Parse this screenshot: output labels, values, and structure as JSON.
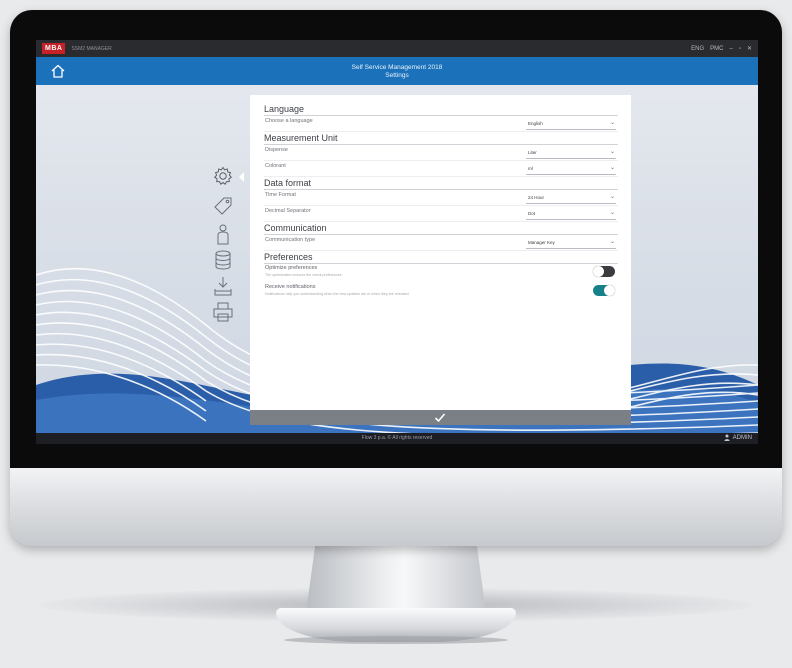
{
  "window": {
    "logo_text": "MBA",
    "app_name": "SSM2 MANAGER",
    "controls": [
      "ENG",
      "PMC",
      "–",
      "▫",
      "✕"
    ]
  },
  "appbar": {
    "title": "Self Service Management 2018",
    "subtitle": "Settings",
    "home_icon": "home-icon"
  },
  "sidenav": {
    "items": [
      {
        "icon": "gear-icon",
        "active": true
      },
      {
        "icon": "tag-icon",
        "active": false
      },
      {
        "icon": "user-icon",
        "active": false
      },
      {
        "icon": "database-icon",
        "active": false
      },
      {
        "icon": "download-tray-icon",
        "active": false
      },
      {
        "icon": "printer-icon",
        "active": false
      }
    ]
  },
  "settings": {
    "language": {
      "title": "Language",
      "rows": [
        {
          "label": "Choose a language",
          "value": "English"
        }
      ]
    },
    "measurement": {
      "title": "Measurement Unit",
      "rows": [
        {
          "label": "Dispense",
          "value": "Liter"
        },
        {
          "label": "Colorant",
          "value": "ml"
        }
      ]
    },
    "dataformat": {
      "title": "Data format",
      "rows": [
        {
          "label": "Time Format",
          "value": "24 Hour"
        },
        {
          "label": "Decimal Separator",
          "value": "Dot"
        }
      ]
    },
    "communication": {
      "title": "Communication",
      "rows": [
        {
          "label": "Communication type",
          "value": "Manager Key"
        }
      ]
    },
    "preferences": {
      "title": "Preferences",
      "rows": [
        {
          "label": "Optimize preferences",
          "desc": "The optimization reduces the check preferences",
          "enabled": false
        },
        {
          "label": "Receive notifications",
          "desc": "Notifications help you understanding when the new updates are or when they are released",
          "enabled": true
        }
      ]
    }
  },
  "confirm_icon": "checkmark-icon",
  "footer": {
    "copyright": "Flow 3 p.a. © All rights reserved",
    "user": "ADMIN"
  },
  "colors": {
    "appbar": "#1b72bb",
    "toggle_on": "#16818a",
    "toggle_off": "#3a3c40"
  }
}
